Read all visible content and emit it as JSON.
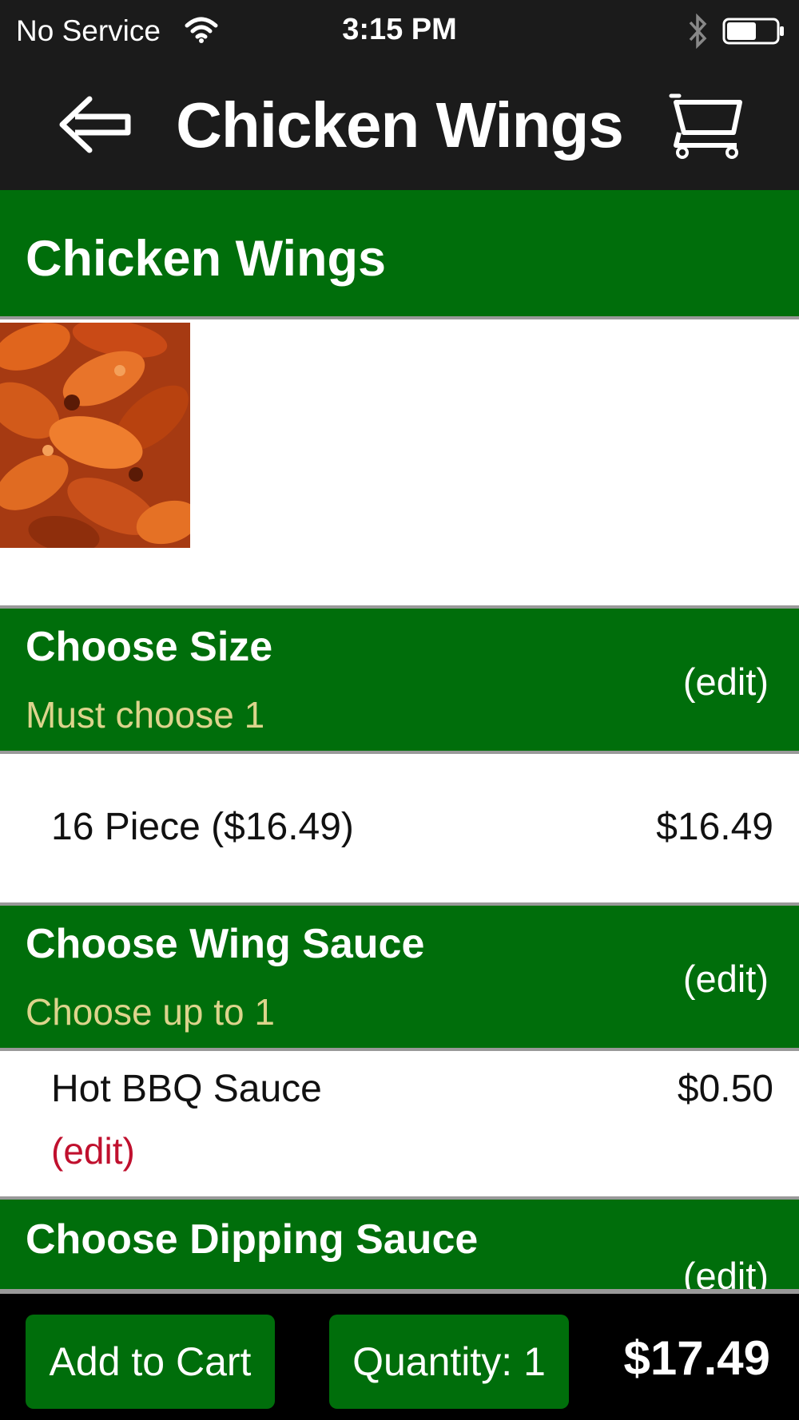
{
  "status_bar": {
    "carrier": "No Service",
    "time": "3:15 PM"
  },
  "nav": {
    "title": "Chicken Wings",
    "back_icon": "back-arrow-icon",
    "cart_icon": "cart-icon"
  },
  "item": {
    "name": "Chicken Wings"
  },
  "sections": [
    {
      "title": "Choose Size",
      "subtitle": "Must choose 1",
      "edit_label": "(edit)",
      "selection": {
        "name": "16 Piece ($16.49)",
        "price": "$16.49"
      }
    },
    {
      "title": "Choose Wing Sauce",
      "subtitle": "Choose up to 1",
      "edit_label": "(edit)",
      "selection": {
        "name": "Hot BBQ Sauce",
        "price": "$0.50",
        "edit_label": "(edit)"
      }
    },
    {
      "title": "Choose Dipping Sauce",
      "edit_label": "(edit)"
    }
  ],
  "bottom": {
    "add_label": "Add to Cart",
    "quantity_label": "Quantity: 1",
    "total": "$17.49"
  },
  "colors": {
    "header_bg": "#1b1b1b",
    "accent_green": "#006e0b",
    "subtitle_gold": "#dcd48c",
    "edit_red": "#c0102e"
  }
}
